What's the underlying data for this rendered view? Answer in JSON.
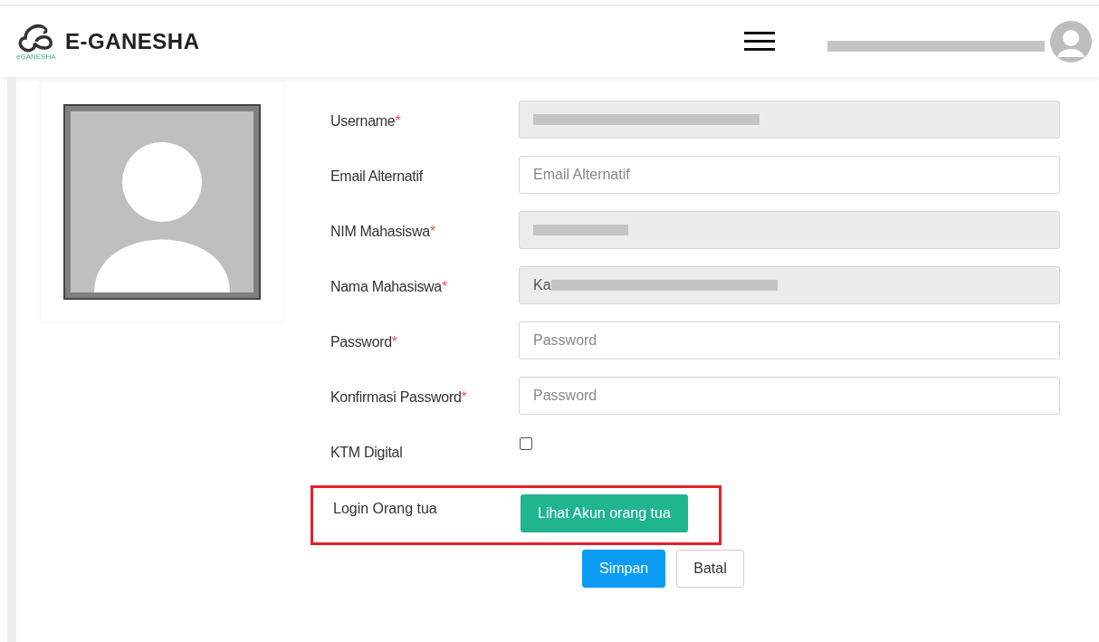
{
  "header": {
    "brand": "E-GANESHA",
    "logo_caption": "eGANESHA",
    "user_redacted": true
  },
  "fields": [
    {
      "kind": "input",
      "label": "Username",
      "marker": "*",
      "readonly": true,
      "redacted": true
    },
    {
      "kind": "input",
      "label": "Email Alternatif",
      "placeholder": "Email Alternatif",
      "readonly": false,
      "redacted": false
    },
    {
      "kind": "input",
      "label": "NIM Mahasiswa",
      "marker": "*",
      "readonly": true,
      "redacted": true
    },
    {
      "kind": "input",
      "label": "Nama Mahasiswa",
      "marker": "*",
      "value": "Ka",
      "readonly": true,
      "redacted": true
    },
    {
      "kind": "input",
      "label": "Password",
      "marker": "*",
      "placeholder": "Password",
      "readonly": false,
      "redacted": false
    },
    {
      "kind": "input",
      "label": "Konfirmasi Password",
      "marker": "*",
      "placeholder": "Password",
      "readonly": false,
      "redacted": false
    },
    {
      "kind": "checkbox",
      "label": "KTM Digital",
      "checked": false
    }
  ],
  "parent_login": {
    "label": "Login Orang tua",
    "button": "Lihat Akun orang tua",
    "highlighted": true
  },
  "actions": [
    {
      "kind": "primary",
      "label": "Simpan"
    },
    {
      "kind": "default",
      "label": "Batal"
    }
  ]
}
